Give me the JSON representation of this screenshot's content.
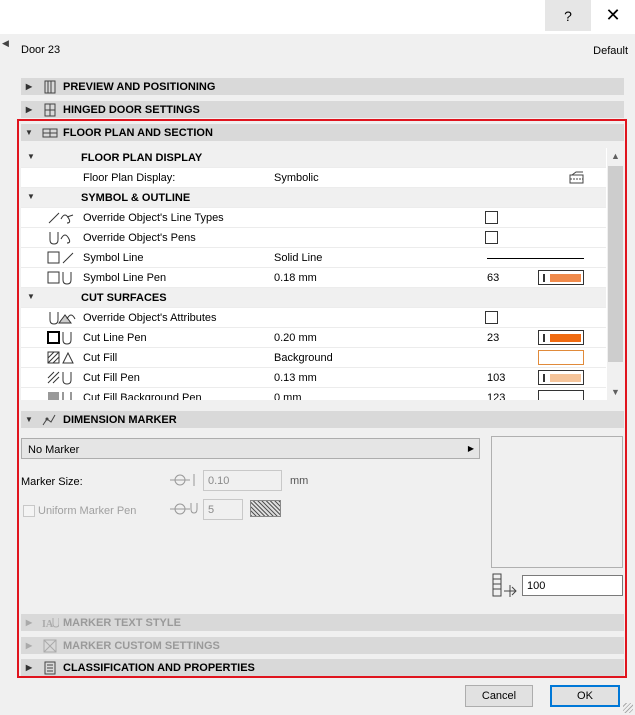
{
  "titlebar": {
    "help_label": "?",
    "close_label": "✕"
  },
  "object": {
    "name": "Door 23",
    "default_label": "Default"
  },
  "sections": {
    "preview": "PREVIEW AND POSITIONING",
    "hinged": "HINGED DOOR SETTINGS",
    "floor_plan": "FLOOR PLAN AND SECTION",
    "dimension": "DIMENSION MARKER",
    "marker_text": "MARKER TEXT STYLE",
    "marker_custom": "MARKER CUSTOM SETTINGS",
    "classification": "CLASSIFICATION AND PROPERTIES"
  },
  "floor_plan": {
    "rows": [
      {
        "label": "FLOOR PLAN DISPLAY"
      },
      {
        "label": "Floor Plan Display:",
        "value": "Symbolic"
      },
      {
        "label": "SYMBOL & OUTLINE"
      },
      {
        "label": "Override Object's Line Types"
      },
      {
        "label": "Override Object's Pens"
      },
      {
        "label": "Symbol Line",
        "value": "Solid Line"
      },
      {
        "label": "Symbol Line Pen",
        "value": "0.18 mm",
        "pen": "63"
      },
      {
        "label": "CUT SURFACES"
      },
      {
        "label": "Override Object's Attributes"
      },
      {
        "label": "Cut Line Pen",
        "value": "0.20 mm",
        "pen": "23"
      },
      {
        "label": "Cut Fill",
        "value": "Background"
      },
      {
        "label": "Cut Fill Pen",
        "value": "0.13 mm",
        "pen": "103"
      },
      {
        "label": "Cut Fill Background Pen",
        "value": "0 mm",
        "pen": "123"
      }
    ],
    "pen_colors": {
      "symbol_line": "#f08a4b",
      "cut_line": "#f06a10",
      "cut_fill_border": "#e08a3a",
      "cut_fill": "#f5c49a"
    }
  },
  "dimension_marker": {
    "marker_type": "No Marker",
    "marker_size_label": "Marker Size:",
    "marker_size_value": "0.10",
    "marker_size_unit": "mm",
    "uniform_pen_label": "Uniform Marker Pen",
    "uniform_pen_value": "5",
    "scale_value": "100"
  },
  "buttons": {
    "cancel": "Cancel",
    "ok": "OK"
  }
}
